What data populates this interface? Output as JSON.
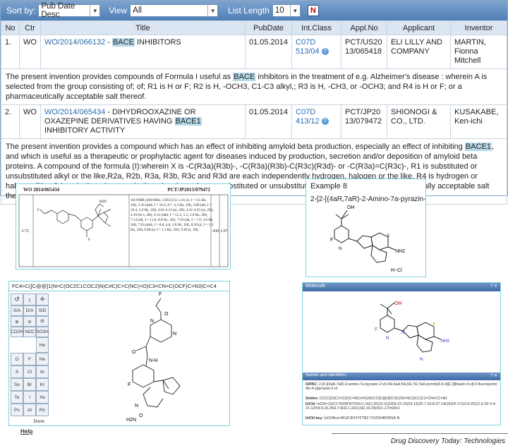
{
  "toolbar": {
    "sort_label": "Sort by:",
    "sort_value": "Pub Date Desc",
    "view_label": "View",
    "view_value": "All",
    "list_length_label": "List Length",
    "list_length_value": "10",
    "pdf_icon": "pdf-export-icon"
  },
  "columns": [
    "No",
    "Ctr",
    "Title",
    "PubDate",
    "Int.Class",
    "Appl.No",
    "Applicant",
    "Inventor"
  ],
  "results": [
    {
      "no": "1.",
      "ctr": "WO",
      "pub_no": "WO/2014/066132",
      "title_pre": " - ",
      "title_hl": "BACE",
      "title_post": " INHIBITORS",
      "pubdate": "01.05.2014",
      "int_class": "C07D 513/04",
      "appl_no": "PCT/US2013/065418",
      "applicant": "ELI LILLY AND COMPANY",
      "inventor": "MARTIN, Fionna Mitchell",
      "abstract_a": "The present invention provides compounds of Formula I useful as ",
      "abstract_hl": "BACE",
      "abstract_b": " inhibitors in the treatment of e.g. Alzheimer's disease : wherein A is selected from the group consisting of; of; R1 is H or F; R2 is H, -OCH3, C1-C3 alkyl,; R3 is H, -CH3, or -OCH3; and R4 is H or F; or a pharmaceutically acceptable salt thereof."
    },
    {
      "no": "2.",
      "ctr": "WO",
      "pub_no": "WO/2014/065434",
      "title_pre": " - DIHYDROOXAZINE OR OXAZEPINE DERIVATIVES HAVING ",
      "title_hl": "BACE1",
      "title_post": " INHIBITORY ACTIVITY",
      "pubdate": "01.05.2014",
      "int_class": "C07D 413/12",
      "appl_no": "PCT/JP2013/079472",
      "applicant": "SHIONOGI & CO., LTD.",
      "inventor": "KUSAKABE, Ken-ichi",
      "abstract_a": "The present invention provides a compound which has an effect of inhibiting amyloid beta production, especially an effect of inhibiting ",
      "abstract_hl": "BACE1",
      "abstract_b": ", and which is useful as a therapeutic or prophylactic agent for diseases induced by production, secretion and/or deposition of amyloid beta proteins. A compound of the formula (I):wherein X is -C(R3a)(R3b)-, -C(R3a)(R3b)-C(R3c)(R3d)- or -C(R3a)=C(R3c)-, R1 is substituted or unsubstituted alkyl or the like,R2a, R2b, R3a, R3b, R3c and R3d are each independently hydrogen, halogen or the like, R4 is hydrogen or halogen,Ring B is substituted or unsubstituted carbocycle or a substituted or unsubstituted heterocycle, or a pharmaceutically acceptable salt thereof."
    }
  ],
  "scan": {
    "header_left": "WO 2014/065434",
    "header_right": "PCT/JP2013/079472",
    "row_id": "I-72",
    "nmr": "1H-NMR (400 MHz, CDCl3) δ: 2.41 (d, J = 0.5 Hz, 1H), 3.26 (ddd, J = 10.4, 8.7, 4.3 Hz, 1H), 3.89 (dd, J = 10.4, 2.6 Hz, 1H), 4.02-4.13 (m, 2H), 4.31-4.35 (m, 2H), 4.39 (br s, 2H), 6.15 (ddd, J = 51.2, 5.5, 2.0 Hz, 2H), 7.14 (dd, J = 11.0, 8.8 Hz, 1H), 7.59 (dd, J = 7.0, 2.8 Hz, 1H), 7.93 (ddd, J = 8.8, 4.0, 2.8 Hz, 1H), 8.29 (d, J = 1.3 Hz, 1H), 9.08 (d, J = 1.3 Hz, 1H), 9.49 (s, 1H).",
    "value1": "430",
    "value2": "1.07"
  },
  "example": {
    "title": "Example 8",
    "name": "2-[2-[(4aR,7aR)-2-Amino-7a-pyrazin-"
  },
  "editor": {
    "smiles": "FC4=C([C@@]1(N=C(OC2C1COC2)N)C#C)C=C(NC(=O)C3=CN=C(OCF)C=N3)C=C4",
    "tools_top": [
      "↺",
      "↕",
      "✛"
    ],
    "tools_row2": [
      "S/A",
      "D/A",
      "S/D"
    ],
    "tools_row3": [
      "⊕",
      "⊖",
      "Θ"
    ],
    "tools_row4": [
      "CO2H",
      "NO2",
      "SO3H"
    ],
    "elements": [
      "He",
      "O",
      "F",
      "Ne",
      "S",
      "Cl",
      "Ar",
      "Se",
      "Br",
      "Kr",
      "Te",
      "I",
      "Xe",
      "Po",
      "At",
      "Rn"
    ],
    "done": "Done",
    "help": "Help"
  },
  "molecule": {
    "title": "Molecule",
    "names_title": "Names and identifiers",
    "iupac_label": "IUPAC:",
    "iupac": "2-[2-[(4aR,7aR)-2-amino-7a-(pyrazin-2-yl)-4H,4aH,5H,6H,7H,7aH-pyrrolo[3,4-d][1,3]thiazin-6-yl]-5-fluoropyrimidin-4-yl]propan-2-ol",
    "smiles_label": "Smiles:",
    "smiles": "CC(C)(O)C1=C(F)C=NC(=N1)N1CC[C@H]2CSC(N)=NC2(C1)C1=CN=CC=N1",
    "inchi_label": "InChI:",
    "inchi": "InChI=1S/C17H20FN7OS/c1-16(2,26)13-11(18)5-22-15(23-13)25-7-10-8-27-14(19)24-17(10,9-25)12-6-20-3-4-21-12/h3-6,10,26H,7-9H2,1-2H3,(H2,19,24)/t10-,17/m0/s1",
    "inchikey_label": "InChI key:",
    "inchikey": "InChIKey=IKUFJKFIYFTBZ-YOZOHBORSA-N"
  },
  "footer": "Drug Discovery Today: Technologies"
}
